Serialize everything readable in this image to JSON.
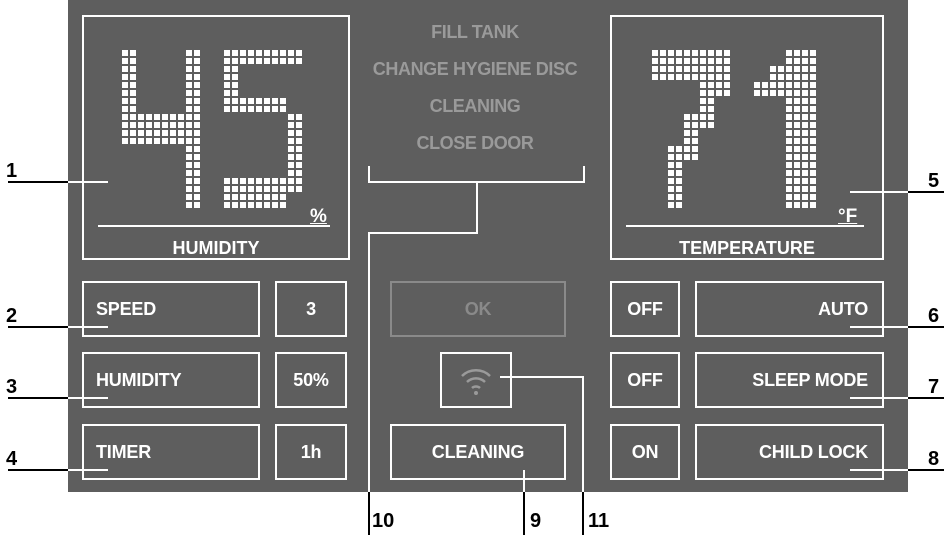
{
  "display": {
    "humidity_value": "45",
    "humidity_unit": "%",
    "humidity_caption": "HUMIDITY",
    "temperature_value": "71",
    "temperature_unit": "°F",
    "temperature_caption": "TEMPERATURE"
  },
  "messages": [
    "FILL TANK",
    "CHANGE HYGIENE DISC",
    "CLEANING",
    "CLOSE DOOR"
  ],
  "left_controls": [
    {
      "label": "SPEED",
      "value": "3"
    },
    {
      "label": "HUMIDITY",
      "value": "50%"
    },
    {
      "label": "TIMER",
      "value": "1h"
    }
  ],
  "center_controls": {
    "ok_label": "OK",
    "wifi_icon": "wifi-icon",
    "cleaning_label": "CLEANING"
  },
  "right_controls": [
    {
      "state": "OFF",
      "label": "AUTO"
    },
    {
      "state": "OFF",
      "label": "SLEEP MODE"
    },
    {
      "state": "ON",
      "label": "CHILD LOCK"
    }
  ],
  "callouts": {
    "n1": "1",
    "n2": "2",
    "n3": "3",
    "n4": "4",
    "n5": "5",
    "n6": "6",
    "n7": "7",
    "n8": "8",
    "n9": "9",
    "n10": "10",
    "n11": "11"
  },
  "colors": {
    "panel": "#5e5e5e",
    "foreground": "#ffffff",
    "inactive": "#9a9a9a",
    "callout": "#000000"
  }
}
